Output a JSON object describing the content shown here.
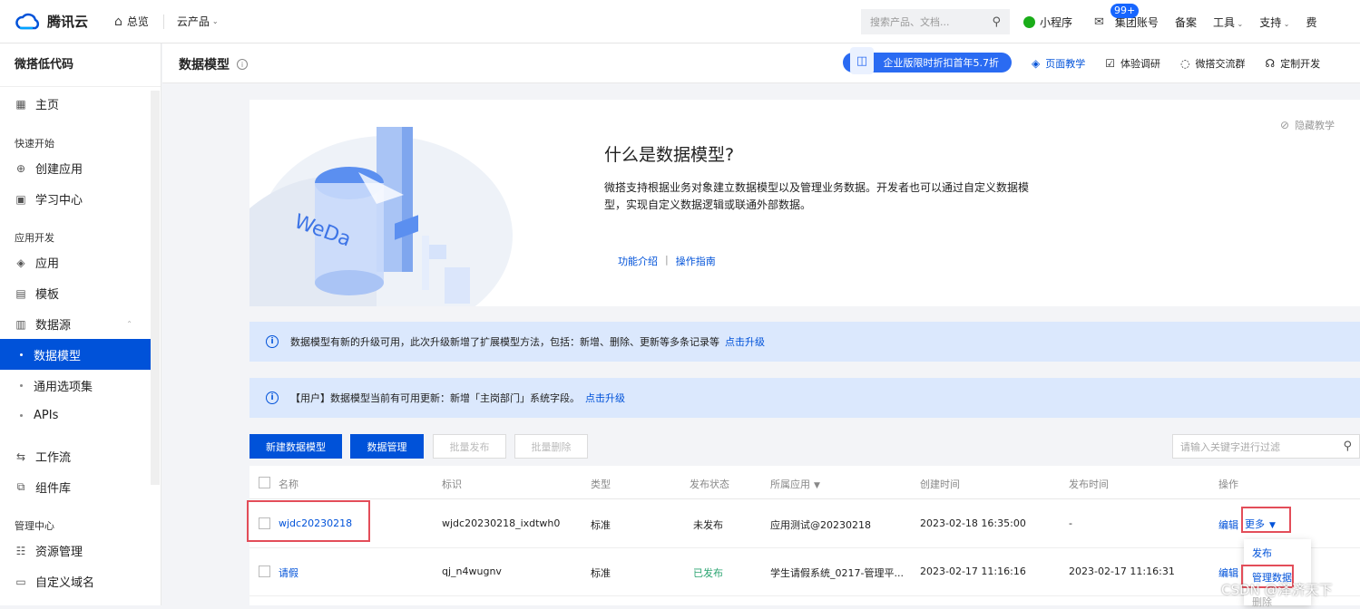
{
  "topbar": {
    "logo_text": "腾讯云",
    "overview": "总览",
    "cloud_products": "云产品",
    "search_placeholder": "搜索产品、文档...",
    "mini_program": "小程序",
    "mail_badge": "99+",
    "group_account": "集团账号",
    "filing": "备案",
    "tools": "工具",
    "support": "支持",
    "fee": "费"
  },
  "sidebar": {
    "app_title": "微搭低代码",
    "home": "主页",
    "group_quick": "快速开始",
    "create_app": "创建应用",
    "learning": "学习中心",
    "group_dev": "应用开发",
    "apps": "应用",
    "templates": "模板",
    "datasource": "数据源",
    "data_model": "数据模型",
    "option_sets": "通用选项集",
    "apis": "APIs",
    "workflow": "工作流",
    "components": "组件库",
    "group_manage": "管理中心",
    "resources": "资源管理",
    "custom_domain": "自定义域名"
  },
  "header": {
    "title": "数据模型",
    "promo": "企业版限时折扣首年5.7折",
    "links": [
      "页面教学",
      "体验调研",
      "微搭交流群",
      "定制开发"
    ]
  },
  "intro": {
    "title": "什么是数据模型?",
    "desc": "微搭支持根据业务对象建立数据模型以及管理业务数据。开发者也可以通过自定义数据模型，实现自定义数据逻辑或联通外部数据。",
    "link_features": "功能介绍",
    "link_sep": "|",
    "link_guide": "操作指南",
    "hide": "隐藏教学",
    "illustration_text": "WeDa"
  },
  "notices": [
    {
      "text": "数据模型有新的升级可用，此次升级新增了扩展模型方法，包括：新增、删除、更新等多条记录等",
      "link": "点击升级"
    },
    {
      "text": "【用户】数据模型当前有可用更新：新增「主岗部门」系统字段。",
      "link": "点击升级"
    }
  ],
  "toolbar": {
    "new_model": "新建数据模型",
    "data_manage": "数据管理",
    "batch_publish": "批量发布",
    "batch_delete": "批量删除",
    "search_placeholder": "请输入关键字进行过滤"
  },
  "table": {
    "headers": [
      "名称",
      "标识",
      "类型",
      "发布状态",
      "所属应用",
      "创建时间",
      "发布时间",
      "操作"
    ],
    "rows": [
      {
        "name": "wjdc20230218",
        "id": "wjdc20230218_ixdtwh0",
        "type": "标准",
        "status": "未发布",
        "app": "应用测试@20230218",
        "created": "2023-02-18 16:35:00",
        "published": "-",
        "edit": "编辑",
        "more": "更多"
      },
      {
        "name": "请假",
        "id": "qj_n4wugnv",
        "type": "标准",
        "status": "已发布",
        "app": "学生请假系统_0217-管理平...",
        "created": "2023-02-17 11:16:16",
        "published": "2023-02-17 11:16:31",
        "edit": "编辑",
        "more": ""
      }
    ]
  },
  "dropdown": {
    "items": [
      "发布",
      "管理数据",
      "删除"
    ]
  },
  "watermark": "CSDN @泽济天下",
  "colors": {
    "primary": "#0052d9",
    "highlight_border": "#e34d59",
    "notice_bg": "#dbe8fd",
    "published": "#2ba471"
  }
}
